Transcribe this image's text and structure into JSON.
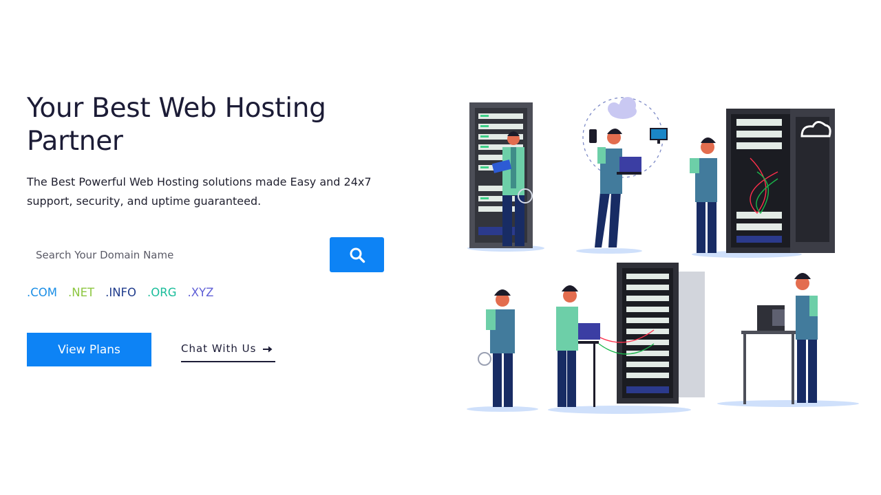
{
  "hero": {
    "title": "Your Best Web Hosting Partner",
    "subtitle": "The Best Powerful Web Hosting solutions made Easy and 24x7 support, security, and uptime guaranteed."
  },
  "search": {
    "placeholder": "Search Your Domain Name",
    "button_icon": "search-icon"
  },
  "tlds": [
    {
      "label": ".COM",
      "color": "#1a8ee6"
    },
    {
      "label": ".NET",
      "color": "#8cc63f"
    },
    {
      "label": ".INFO",
      "color": "#1f3b8c"
    },
    {
      "label": ".ORG",
      "color": "#1bbd9b"
    },
    {
      "label": ".XYZ",
      "color": "#5f5fd6"
    }
  ],
  "actions": {
    "view_plans": "View Plans",
    "chat": "Chat With Us",
    "chat_icon": "arrow-right-icon"
  },
  "colors": {
    "primary": "#0d83f5",
    "heading": "#1c1c36"
  },
  "illustration": {
    "icon": "server-room-illustration"
  }
}
